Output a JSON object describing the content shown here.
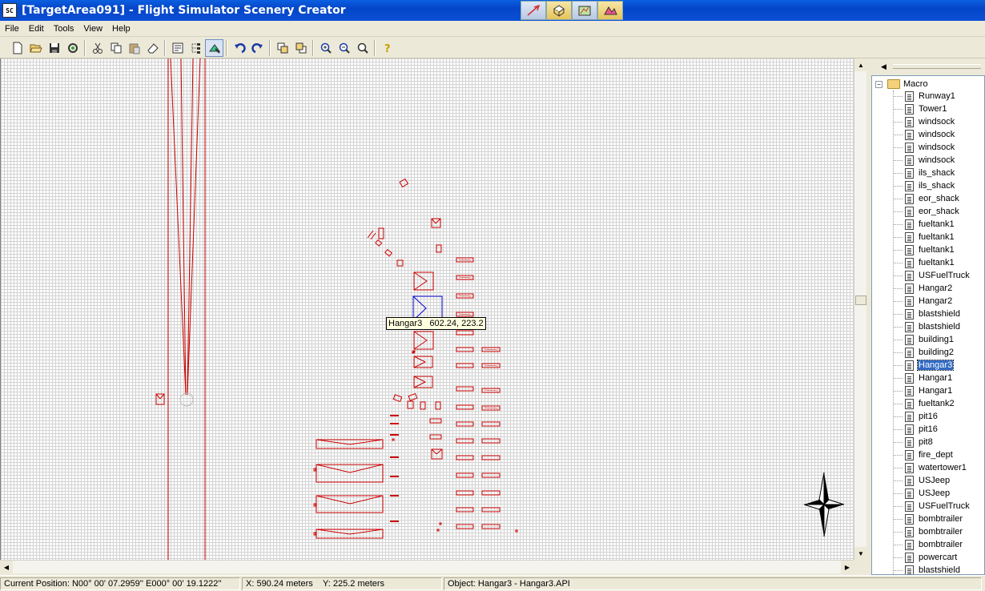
{
  "window": {
    "title": "[TargetArea091] - Flight Simulator Scenery Creator",
    "icon": "SC"
  },
  "title_tools": [
    {
      "icon": "plane-icon"
    },
    {
      "icon": "package-icon"
    },
    {
      "icon": "map-icon"
    },
    {
      "icon": "terrain-icon"
    }
  ],
  "menu": [
    "File",
    "Edit",
    "Tools",
    "View",
    "Help"
  ],
  "toolbar": {
    "groups": [
      [
        "new-file-icon",
        "open-folder-icon",
        "save-icon",
        "compile-icon"
      ],
      [
        "cut-icon",
        "copy-icon",
        "paste-icon",
        "eraser-icon"
      ],
      [
        "properties-icon",
        "layers-icon",
        "select-object-icon"
      ],
      [
        "undo-icon",
        "redo-icon"
      ],
      [
        "bring-front-icon",
        "send-back-icon"
      ],
      [
        "zoom-in-icon",
        "zoom-out-icon",
        "zoom-fit-icon"
      ],
      [
        "help-icon"
      ]
    ]
  },
  "canvas": {
    "tooltip": "Hangar3   602.24, 223.2",
    "colors": {
      "object": "#cc0000",
      "selected": "#0000cc",
      "grid": "#d2d2d2"
    }
  },
  "tree": {
    "root": "Macro",
    "items": [
      "Runway1",
      "Tower1",
      "windsock",
      "windsock",
      "windsock",
      "windsock",
      "ils_shack",
      "ils_shack",
      "eor_shack",
      "eor_shack",
      "fueltank1",
      "fueltank1",
      "fueltank1",
      "fueltank1",
      "USFuelTruck",
      "Hangar2",
      "Hangar2",
      "blastshield",
      "blastshield",
      "building1",
      "building2",
      "Hangar3",
      "Hangar1",
      "Hangar1",
      "fueltank2",
      "pit16",
      "pit16",
      "pit8",
      "fire_dept",
      "watertower1",
      "USJeep",
      "USJeep",
      "USFuelTruck",
      "bombtrailer",
      "bombtrailer",
      "bombtrailer",
      "powercart",
      "blastshield"
    ],
    "selected_index": 21
  },
  "status": {
    "position": "Current Position: N00° 00' 07.2959''  E000° 00' 19.1222''",
    "x": "X: 590.24 meters",
    "y": "Y: 225.2 meters",
    "object": "Object: Hangar3 - Hangar3.API"
  }
}
